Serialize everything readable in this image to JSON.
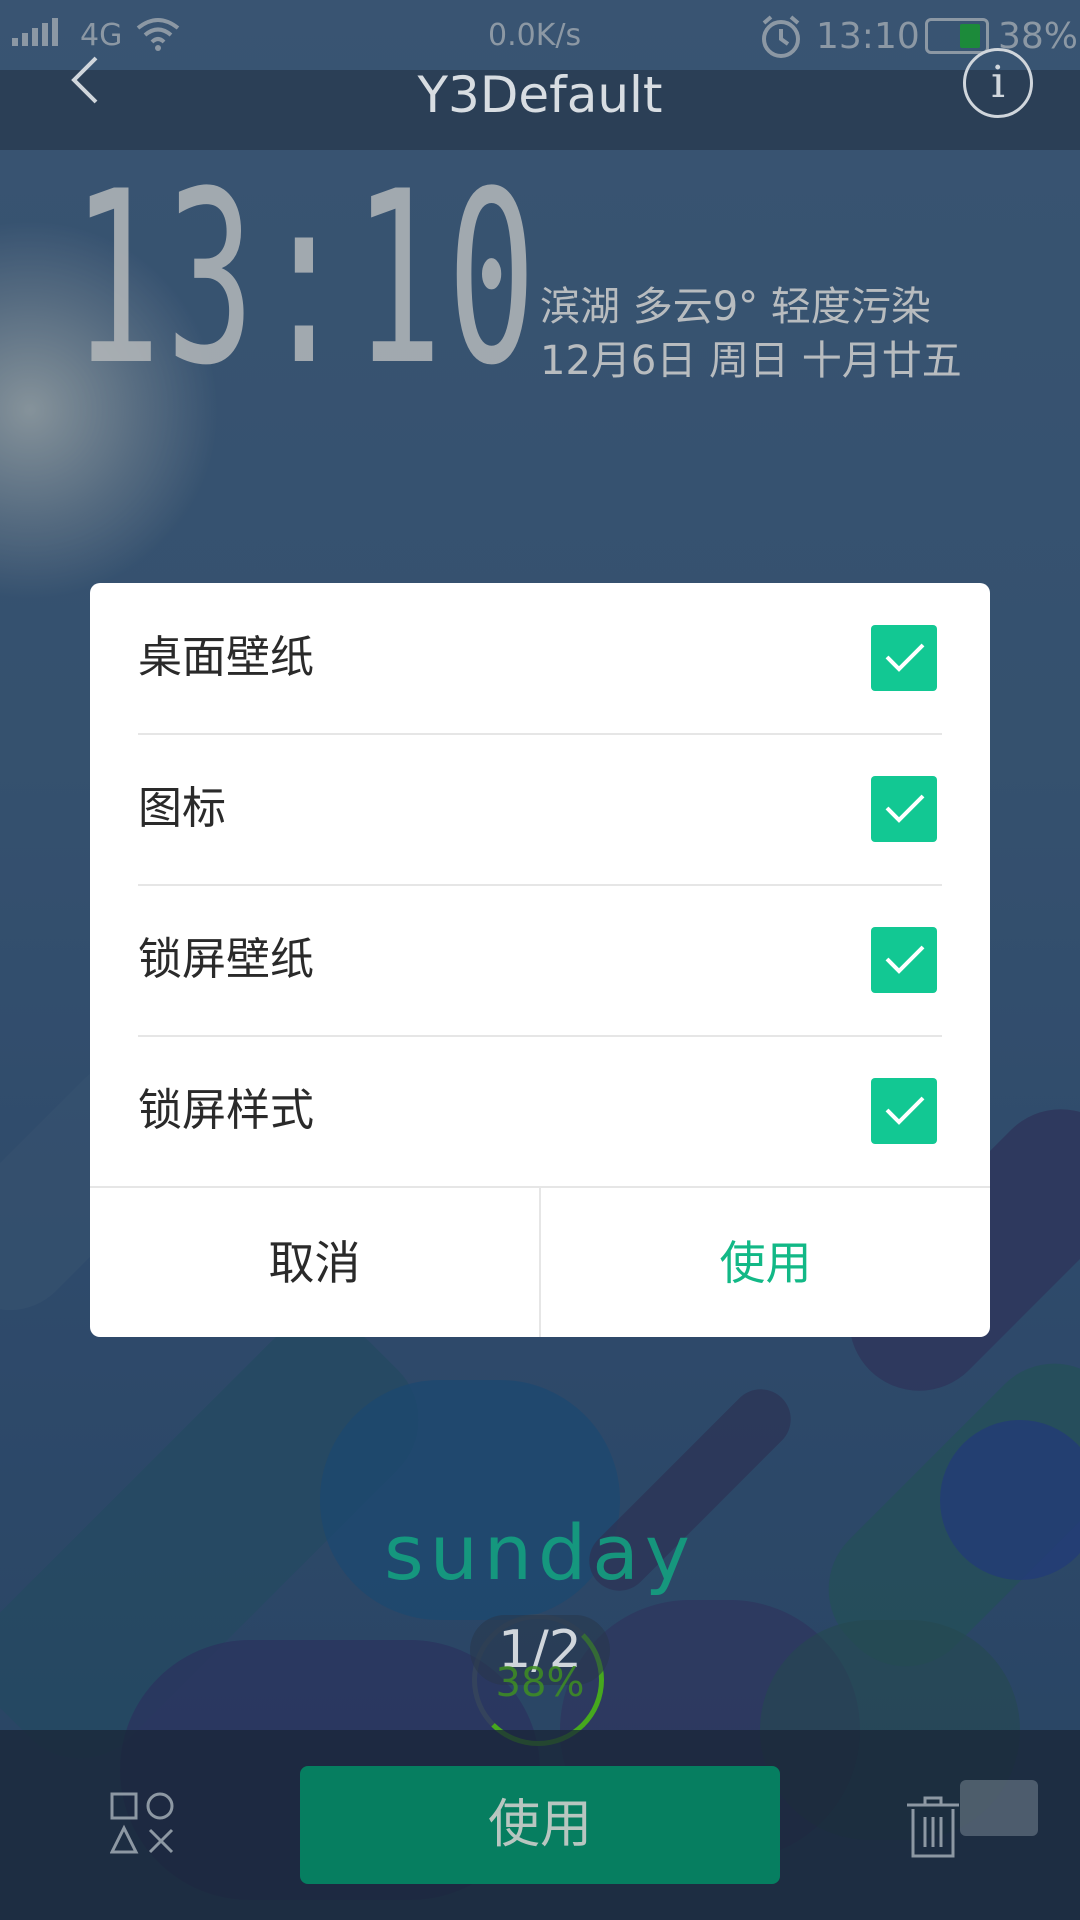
{
  "status_bar": {
    "network": "4G",
    "speed": "0.0K/s",
    "time": "13:10",
    "battery": "38%",
    "battery_level": 0.38,
    "battery_color": "#1c8a3a"
  },
  "header": {
    "title": "Y3Default",
    "back_icon": "chevron-left-icon",
    "info_icon": "info-icon"
  },
  "preview": {
    "clock": "13:10",
    "weather_line": "滨湖 多云9°  轻度污染",
    "date_line": "12月6日 周日 十月廿五",
    "day_word": "sunday",
    "pager": "1/2",
    "progress": "38%"
  },
  "dialog": {
    "options": [
      {
        "label": "桌面壁纸",
        "checked": true
      },
      {
        "label": "图标",
        "checked": true
      },
      {
        "label": "锁屏壁纸",
        "checked": true
      },
      {
        "label": "锁屏样式",
        "checked": true
      }
    ],
    "cancel_label": "取消",
    "apply_label": "使用",
    "accent_color": "#12c893"
  },
  "bottom_bar": {
    "apply_label": "使用",
    "left_icon": "shapes-icon",
    "right_icon": "trash-icon"
  }
}
